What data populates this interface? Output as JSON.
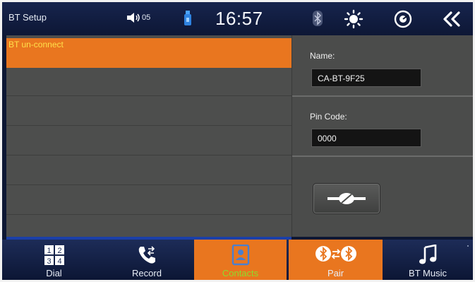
{
  "topbar": {
    "title": "BT Setup",
    "volume": "05",
    "time": "16:57",
    "icons": [
      "speaker-icon",
      "usb-icon",
      "bluetooth-icon",
      "brightness-icon",
      "navigation-icon",
      "back-icon"
    ]
  },
  "device_list": {
    "status": "BT un-connect"
  },
  "settings": {
    "name_label": "Name:",
    "name_value": "CA-BT-9F25",
    "pin_label": "Pin Code:",
    "pin_value": "0000",
    "connect_icon": "link-icon"
  },
  "dock": {
    "items": [
      {
        "label": "Dial",
        "icon": "dialpad-icon"
      },
      {
        "label": "Record",
        "icon": "call-record-icon"
      },
      {
        "label": "Contacts",
        "icon": "contacts-icon"
      },
      {
        "label": "Pair",
        "icon": "bluetooth-pair-icon"
      },
      {
        "label": "BT Music",
        "icon": "music-note-icon"
      }
    ]
  },
  "colors": {
    "accent": "#e9761f",
    "status_text": "#ffe14a",
    "contacts_label": "#8ddc2c",
    "panel": "#4d4e4d",
    "bar": "#0d1733"
  }
}
